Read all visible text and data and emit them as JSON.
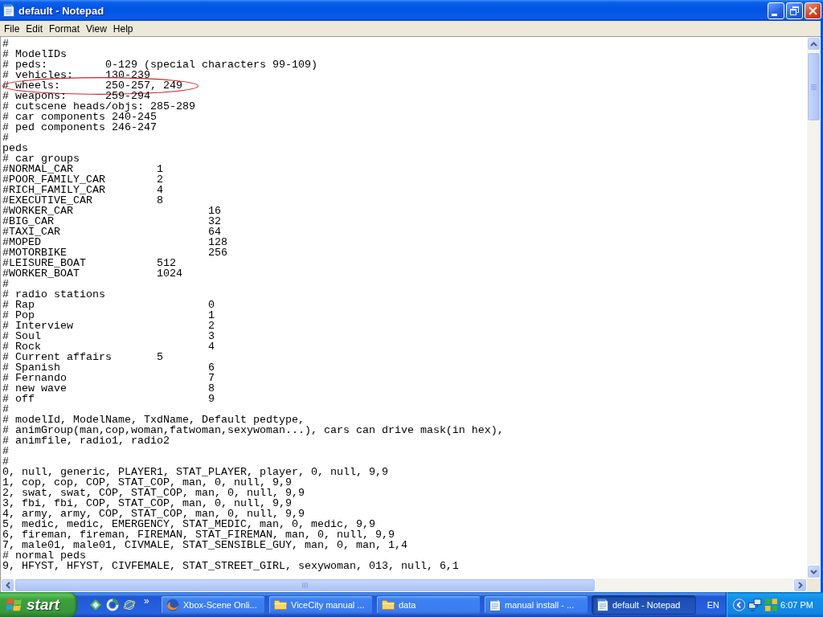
{
  "window": {
    "title": "default - Notepad"
  },
  "menu": [
    "File",
    "Edit",
    "Format",
    "View",
    "Help"
  ],
  "document": {
    "lines": [
      {
        "text": "#",
        "circled": false
      },
      {
        "text": "# ModelIDs",
        "circled": false
      },
      {
        "text": "# peds:         0-129 (special characters 99-109)",
        "circled": false
      },
      {
        "text": "# vehicles:     130-239",
        "circled": false
      },
      {
        "text": "# wheels:       250-257, 249",
        "circled": true
      },
      {
        "text": "# weapons:      259-294",
        "circled": false
      },
      {
        "text": "# cutscene heads/objs: 285-289",
        "circled": false
      },
      {
        "text": "# car components 240-245",
        "circled": false
      },
      {
        "text": "# ped components 246-247",
        "circled": false
      },
      {
        "text": "#",
        "circled": false
      },
      {
        "text": "peds",
        "circled": false
      },
      {
        "text": "# car groups",
        "circled": false
      },
      {
        "text": "#NORMAL_CAR             1",
        "circled": false
      },
      {
        "text": "#POOR_FAMILY_CAR        2",
        "circled": false
      },
      {
        "text": "#RICH_FAMILY_CAR        4",
        "circled": false
      },
      {
        "text": "#EXECUTIVE_CAR          8",
        "circled": false
      },
      {
        "text": "#WORKER_CAR                     16",
        "circled": false
      },
      {
        "text": "#BIG_CAR                        32",
        "circled": false
      },
      {
        "text": "#TAXI_CAR                       64",
        "circled": false
      },
      {
        "text": "#MOPED                          128",
        "circled": false
      },
      {
        "text": "#MOTORBIKE                      256",
        "circled": false
      },
      {
        "text": "#LEISURE_BOAT           512",
        "circled": false
      },
      {
        "text": "#WORKER_BOAT            1024",
        "circled": false
      },
      {
        "text": "#",
        "circled": false
      },
      {
        "text": "# radio stations",
        "circled": false
      },
      {
        "text": "# Rap                           0",
        "circled": false
      },
      {
        "text": "# Pop                           1",
        "circled": false
      },
      {
        "text": "# Interview                     2",
        "circled": false
      },
      {
        "text": "# Soul                          3",
        "circled": false
      },
      {
        "text": "# Rock                          4",
        "circled": false
      },
      {
        "text": "# Current affairs       5",
        "circled": false
      },
      {
        "text": "# Spanish                       6",
        "circled": false
      },
      {
        "text": "# Fernando                      7",
        "circled": false
      },
      {
        "text": "# new wave                      8",
        "circled": false
      },
      {
        "text": "# off                           9",
        "circled": false
      },
      {
        "text": "#",
        "circled": false
      },
      {
        "text": "# modelId, ModelName, TxdName, Default pedtype,",
        "circled": false
      },
      {
        "text": "# animGroup(man,cop,woman,fatwoman,sexywoman...), cars can drive mask(in hex),",
        "circled": false
      },
      {
        "text": "# animfile, radio1, radio2",
        "circled": false
      },
      {
        "text": "#",
        "circled": false
      },
      {
        "text": "#",
        "circled": false
      },
      {
        "text": "0, null, generic, PLAYER1, STAT_PLAYER, player, 0, null, 9,9",
        "circled": false
      },
      {
        "text": "1, cop, cop, COP, STAT_COP, man, 0, null, 9,9",
        "circled": false
      },
      {
        "text": "2, swat, swat, COP, STAT_COP, man, 0, null, 9,9",
        "circled": false
      },
      {
        "text": "3, fbi, fbi, COP, STAT_COP, man, 0, null, 9,9",
        "circled": false
      },
      {
        "text": "4, army, army, COP, STAT_COP, man, 0, null, 9,9",
        "circled": false
      },
      {
        "text": "5, medic, medic, EMERGENCY, STAT_MEDIC, man, 0, medic, 9,9",
        "circled": false
      },
      {
        "text": "6, fireman, fireman, FIREMAN, STAT_FIREMAN, man, 0, null, 9,9",
        "circled": false
      },
      {
        "text": "7, male01, male01, CIVMALE, STAT_SENSIBLE_GUY, man, 0, man, 1,4",
        "circled": false
      },
      {
        "text": "# normal peds",
        "circled": false
      },
      {
        "text": "9, HFYST, HFYST, CIVFEMALE, STAT_STREET_GIRL, sexywoman, 013, null, 6,1",
        "circled": false
      }
    ]
  },
  "taskbar": {
    "start": "start",
    "quick_launch_overflow": "»",
    "tasks": [
      {
        "label": "Xbox-Scene Onli...",
        "kind": "browser",
        "selected": false
      },
      {
        "label": "ViceCity manual ...",
        "kind": "folder",
        "selected": false
      },
      {
        "label": "data",
        "kind": "folder",
        "selected": false
      },
      {
        "label": "manual install - ...",
        "kind": "notepad",
        "selected": false
      },
      {
        "label": "default - Notepad",
        "kind": "notepad",
        "selected": true
      }
    ],
    "language": "EN",
    "clock": "6:07 PM"
  }
}
